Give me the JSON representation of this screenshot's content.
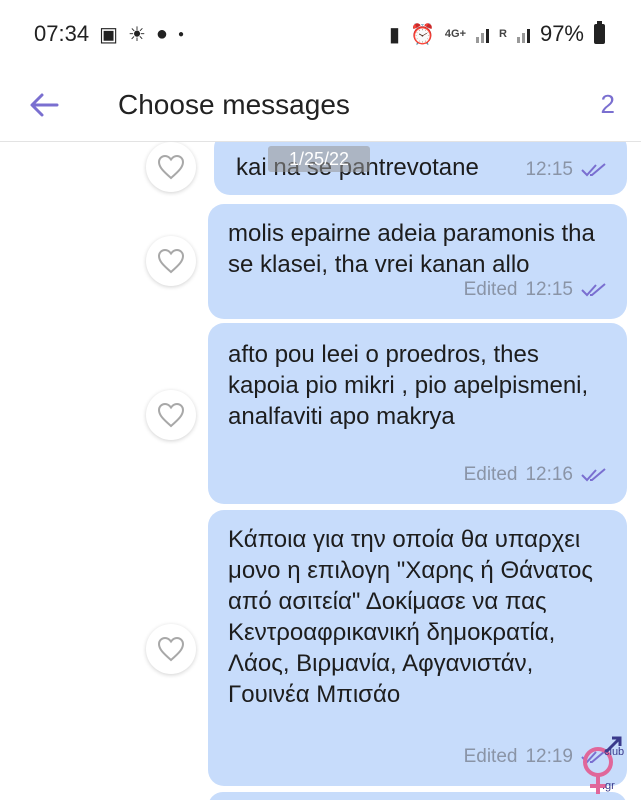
{
  "status_bar": {
    "time": "07:34",
    "network": "4G+",
    "roaming": "R",
    "battery": "97%"
  },
  "app_bar": {
    "title": "Choose messages",
    "selected_count": "2"
  },
  "date_chip": "1/25/22",
  "messages": [
    {
      "text": "kai na se pantrevotane",
      "edited": "",
      "time": "12:15"
    },
    {
      "text": "molis epairne adeia paramonis tha se klasei, tha vrei kanan allo",
      "edited": "Edited",
      "time": "12:15"
    },
    {
      "text": "afto pou leei o proedros, thes kapoia pio mikri , pio apelpismeni, analfaviti apo makrya",
      "edited": "Edited",
      "time": "12:16"
    },
    {
      "text": "Κάποια για την οποία θα υπαρχει μονο η επιλογη \"Χαρης ή  Θάνατος από ασιτεία\" Δοκίμασε να πας Κεντροαφρικανική δημοκρατία, Λάος, Βιρμανία, Αφγανιστάν, Γουινέα Μπισάο",
      "edited": "Edited",
      "time": "12:19"
    }
  ],
  "watermark": {
    "main": "sex",
    "club": "club",
    "tld": ".gr"
  },
  "colors": {
    "accent": "#7a6fd0",
    "bubble": "#c7dcfb",
    "read_check": "#7a6fd0"
  }
}
